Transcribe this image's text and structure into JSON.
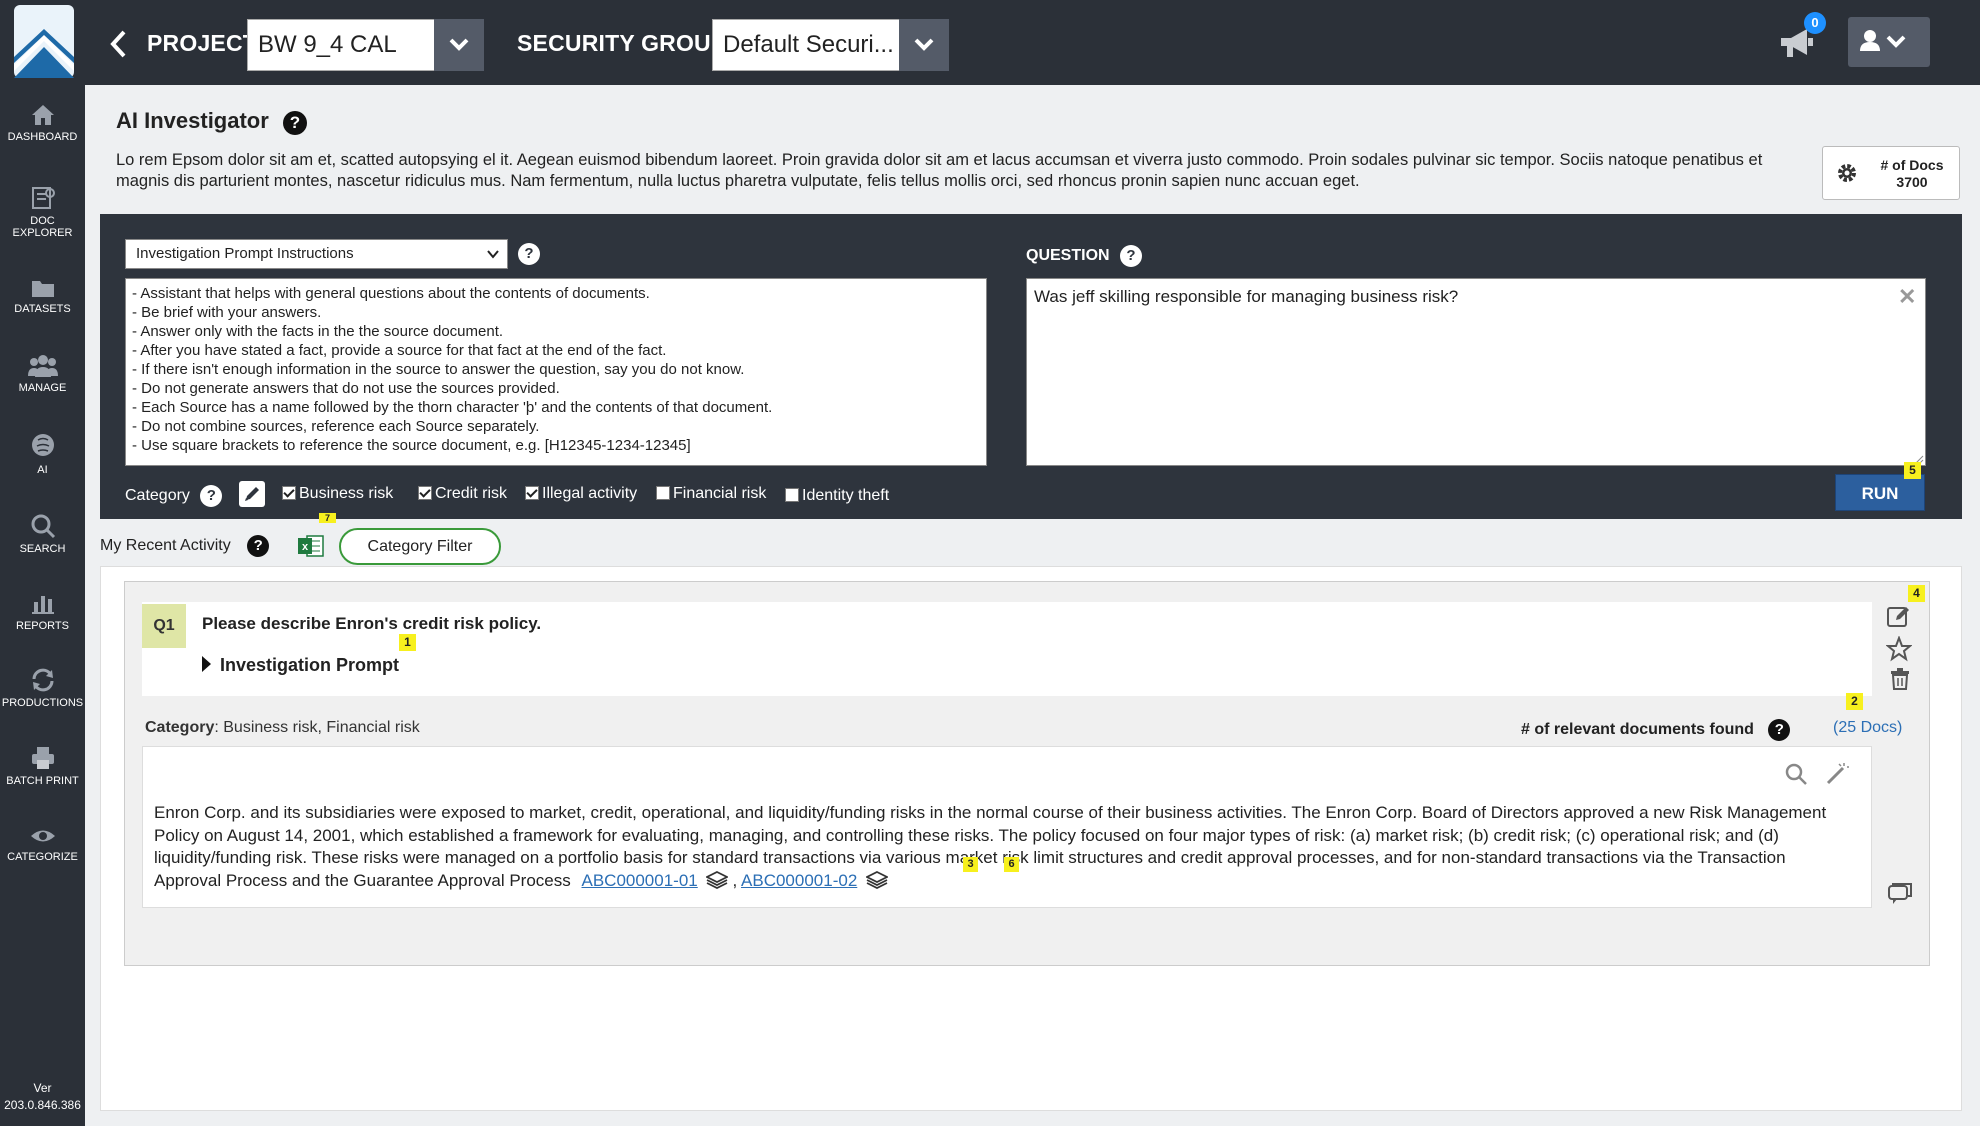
{
  "header": {
    "project_label": "PROJECT:",
    "project_value": "BW 9_4 CAL",
    "security_label": "SECURITY GROUP:",
    "security_value": "Default Securi...",
    "notification_count": "0"
  },
  "sidebar": {
    "items": [
      {
        "label": "DASHBOARD",
        "icon": "home-icon"
      },
      {
        "label": "DOC EXPLORER",
        "icon": "doc-explorer-icon"
      },
      {
        "label": "DATASETS",
        "icon": "folder-icon"
      },
      {
        "label": "MANAGE",
        "icon": "users-icon"
      },
      {
        "label": "AI",
        "icon": "brain-icon"
      },
      {
        "label": "SEARCH",
        "icon": "search-icon"
      },
      {
        "label": "REPORTS",
        "icon": "bar-chart-icon"
      },
      {
        "label": "PRODUCTIONS",
        "icon": "refresh-icon"
      },
      {
        "label": "BATCH PRINT",
        "icon": "printer-icon"
      },
      {
        "label": "CATEGORIZE",
        "icon": "eye-icon"
      }
    ],
    "version_label": "Ver",
    "version": "203.0.846.386"
  },
  "page": {
    "title": "AI Investigator",
    "description": "Lo rem Epsom dolor sit am et, scatted autopsying el it. Aegean euismod bibendum laoreet. Proin gravida dolor sit am et lacus accumsan et viverra justo commodo. Proin sodales pulvinar sic tempor. Sociis natoque penatibus et magnis dis parturient montes, nascetur ridiculus mus. Nam fermentum, nulla luctus pharetra vulputate, felis tellus mollis orci, sed rhoncus pronin sapien nunc accuan eget.",
    "docs_label": "# of Docs",
    "docs_count": "3700"
  },
  "prompt": {
    "select_value": "Investigation Prompt Instructions",
    "lines": [
      "- Assistant that helps with general questions about the contents of documents.",
      "- Be brief with your answers.",
      "- Answer only with the facts in the the source document.",
      "- After you have stated a fact, provide a source for that fact at the end of the fact.",
      "- If there isn't enough information in the source to answer the question, say you do not know.",
      "- Do not generate answers that do not use the sources provided.",
      "- Each Source has a name followed by the thorn character 'þ' and the contents of that document.",
      "- Do not combine sources, reference each Source separately.",
      "- Use square brackets to reference the source document, e.g. [H12345-1234-12345]"
    ]
  },
  "question": {
    "label": "QUESTION",
    "value": "Was jeff skilling responsible for managing business risk?",
    "run_label": "RUN"
  },
  "categories": {
    "label": "Category",
    "items": [
      {
        "label": "Business risk",
        "checked": true
      },
      {
        "label": "Credit risk",
        "checked": true
      },
      {
        "label": "Illegal activity",
        "checked": true
      },
      {
        "label": "Financial risk",
        "checked": false
      },
      {
        "label": "Identity theft",
        "checked": false
      }
    ]
  },
  "recent": {
    "label": "My Recent Activity",
    "filter_label": "Category Filter"
  },
  "result": {
    "q_tag": "Q1",
    "question": "Please describe Enron's credit risk policy.",
    "prompt_toggle": "Investigation Prompt",
    "category_label": "Category",
    "category_values": ": Business risk, Financial risk",
    "relevant_label": "# of relevant documents found",
    "docs_link": "(25 Docs)",
    "answer": "Enron Corp. and its subsidiaries were exposed to market, credit, operational, and liquidity/funding risks in the normal course of their business activities. The Enron Corp. Board of Directors approved a new Risk Management Policy on August 14, 2001, which established a framework for evaluating, managing, and controlling these risks. The policy focused on four major types of risk: (a) market risk; (b) credit risk; (c) operational risk; and (d) liquidity/funding risk. These risks were managed on a portfolio basis for standard transactions via various market risk limit structures and credit approval processes, and for non-standard transactions via the Transaction Approval Process and the Guarantee Approval Process",
    "source1": "ABC000001-01",
    "source_sep": ",",
    "source2": "ABC000001-02"
  },
  "badges": [
    "1",
    "2",
    "3",
    "4",
    "5",
    "6",
    "7"
  ],
  "colors": {
    "dark": "#2b3038",
    "panel": "#2e343d",
    "accent": "#2c5f9e",
    "badge": "#f7f01e",
    "q_tag": "#dfe6a6",
    "filter_border": "#3a9a3a",
    "link": "#2c6fb5"
  }
}
